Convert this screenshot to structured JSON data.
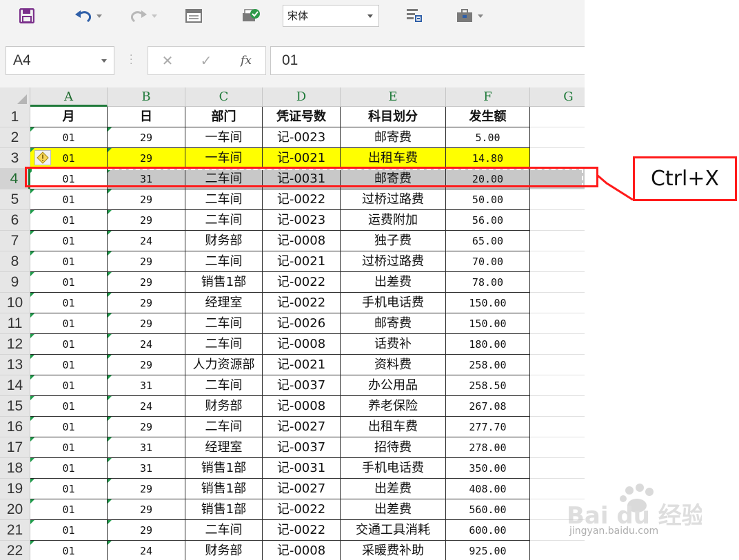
{
  "toolbar": {
    "font_name": "宋体",
    "colors": {
      "save": "#7a2f8a",
      "undo": "#2f5fa8",
      "icon_gray": "#8a8a8a"
    }
  },
  "formula_bar": {
    "name_box": "A4",
    "cancel": "✕",
    "confirm": "✓",
    "fx": "fx",
    "value": "01"
  },
  "columns": [
    "A",
    "B",
    "C",
    "D",
    "E",
    "F",
    "G"
  ],
  "row_numbers": [
    "1",
    "2",
    "3",
    "4",
    "5",
    "6",
    "7",
    "8",
    "9",
    "10",
    "11",
    "12",
    "13",
    "14",
    "15",
    "16",
    "17",
    "18",
    "19",
    "20",
    "21",
    "22"
  ],
  "header": [
    "月",
    "日",
    "部门",
    "凭证号数",
    "科目划分",
    "发生额"
  ],
  "rows": [
    [
      "01",
      "29",
      "一车间",
      "记-0023",
      "邮寄费",
      "5.00"
    ],
    [
      "01",
      "29",
      "一车间",
      "记-0021",
      "出租车费",
      "14.80"
    ],
    [
      "01",
      "31",
      "二车间",
      "记-0031",
      "邮寄费",
      "20.00"
    ],
    [
      "01",
      "29",
      "二车间",
      "记-0022",
      "过桥过路费",
      "50.00"
    ],
    [
      "01",
      "29",
      "二车间",
      "记-0023",
      "运费附加",
      "56.00"
    ],
    [
      "01",
      "24",
      "财务部",
      "记-0008",
      "独子费",
      "65.00"
    ],
    [
      "01",
      "29",
      "二车间",
      "记-0021",
      "过桥过路费",
      "70.00"
    ],
    [
      "01",
      "29",
      "销售1部",
      "记-0022",
      "出差费",
      "78.00"
    ],
    [
      "01",
      "29",
      "经理室",
      "记-0022",
      "手机电话费",
      "150.00"
    ],
    [
      "01",
      "29",
      "二车间",
      "记-0026",
      "邮寄费",
      "150.00"
    ],
    [
      "01",
      "24",
      "二车间",
      "记-0008",
      "话费补",
      "180.00"
    ],
    [
      "01",
      "29",
      "人力资源部",
      "记-0021",
      "资料费",
      "258.00"
    ],
    [
      "01",
      "31",
      "二车间",
      "记-0037",
      "办公用品",
      "258.50"
    ],
    [
      "01",
      "24",
      "财务部",
      "记-0008",
      "养老保险",
      "267.08"
    ],
    [
      "01",
      "29",
      "二车间",
      "记-0027",
      "出租车费",
      "277.70"
    ],
    [
      "01",
      "31",
      "经理室",
      "记-0037",
      "招待费",
      "278.00"
    ],
    [
      "01",
      "31",
      "销售1部",
      "记-0031",
      "手机电话费",
      "350.00"
    ],
    [
      "01",
      "29",
      "销售1部",
      "记-0027",
      "出差费",
      "408.00"
    ],
    [
      "01",
      "29",
      "销售1部",
      "记-0022",
      "出差费",
      "560.00"
    ],
    [
      "01",
      "29",
      "二车间",
      "记-0022",
      "交通工具消耗",
      "600.00"
    ],
    [
      "01",
      "24",
      "财务部",
      "记-0008",
      "采暖费补助",
      "925.00"
    ]
  ],
  "highlight": {
    "yellow_row": "3",
    "cut_row": "4",
    "yellow": "#ffff00",
    "gray": "#c8c8c8"
  },
  "annotation": {
    "callout_text": "Ctrl+X",
    "color": "#ff1a1a"
  },
  "watermark": {
    "brand": "Bai du 经验",
    "url": "jingyan.baidu.com"
  }
}
